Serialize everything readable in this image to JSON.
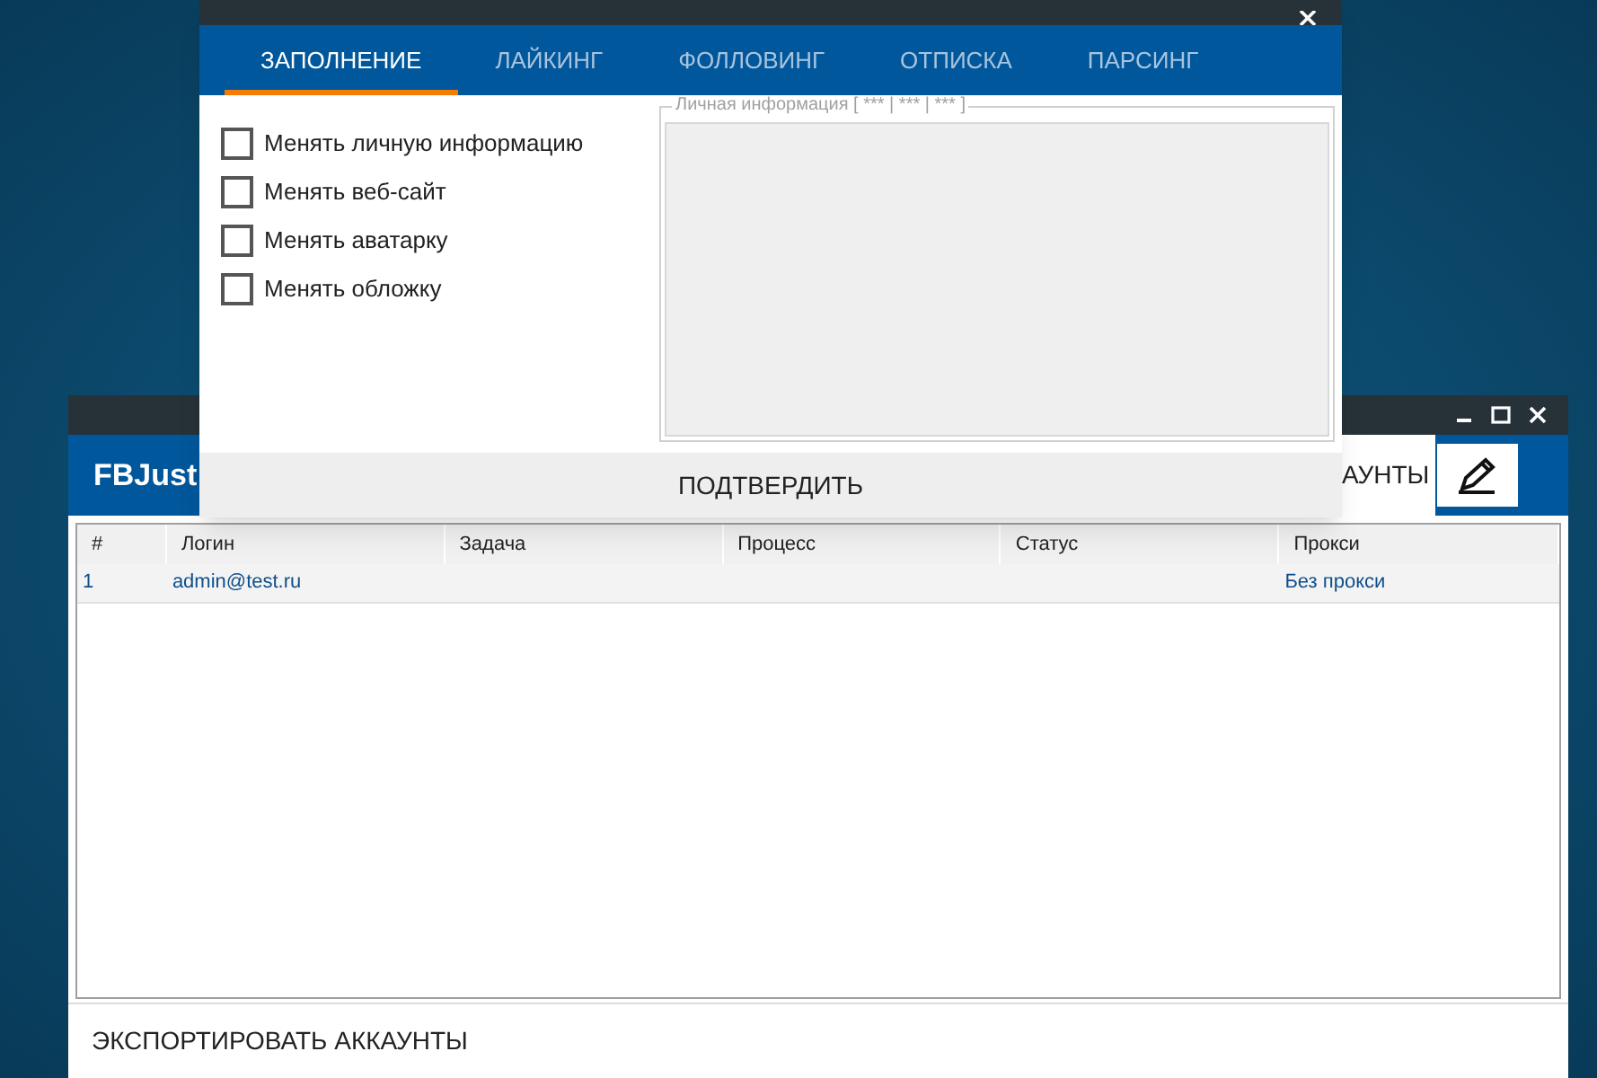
{
  "main_window": {
    "title": "FBJust",
    "header_tab": "АУНТЫ",
    "table": {
      "columns": [
        "#",
        "Логин",
        "Задача",
        "Процесс",
        "Статус",
        "Прокси"
      ],
      "rows": [
        [
          "1",
          "admin@test.ru",
          "",
          "",
          "",
          "Без прокси"
        ]
      ]
    },
    "footer_button": "ЭКСПОРТИРОВАТЬ АККАУНТЫ"
  },
  "dialog": {
    "tabs": [
      {
        "label": "ЗАПОЛНЕНИЕ",
        "selected": true
      },
      {
        "label": "ЛАЙКИНГ",
        "selected": false
      },
      {
        "label": "ФОЛЛОВИНГ",
        "selected": false
      },
      {
        "label": "ОТПИСКА",
        "selected": false
      },
      {
        "label": "ПАРСИНГ",
        "selected": false
      }
    ],
    "options": [
      {
        "label": "Менять личную информацию",
        "checked": false
      },
      {
        "label": "Менять веб-сайт",
        "checked": false
      },
      {
        "label": "Менять аватарку",
        "checked": false
      },
      {
        "label": "Менять обложку",
        "checked": false
      }
    ],
    "group_title": "Личная информация [ *** | *** | *** ]",
    "confirm_button": "ПОДТВЕРДИТЬ"
  }
}
